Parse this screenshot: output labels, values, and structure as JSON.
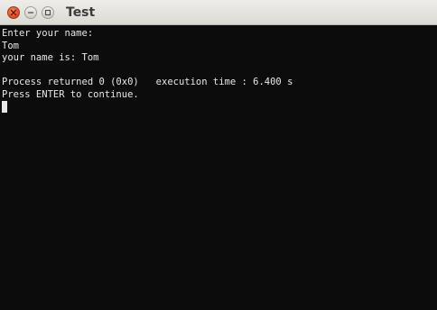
{
  "window": {
    "title": "Test"
  },
  "titlebar": {
    "buttons": {
      "close_icon": "close-icon",
      "minimize_icon": "minimize-icon",
      "maximize_icon": "maximize-icon"
    }
  },
  "terminal": {
    "lines": [
      "Enter your name:",
      "Tom",
      "your name is: Tom",
      "",
      "Process returned 0 (0x0)   execution time : 6.400 s",
      "Press ENTER to continue."
    ]
  },
  "colors": {
    "terminal_bg": "#0c0c0c",
    "terminal_fg": "#e8e8e8",
    "close_button": "#dd4814",
    "titlebar": "#dcdad5"
  }
}
